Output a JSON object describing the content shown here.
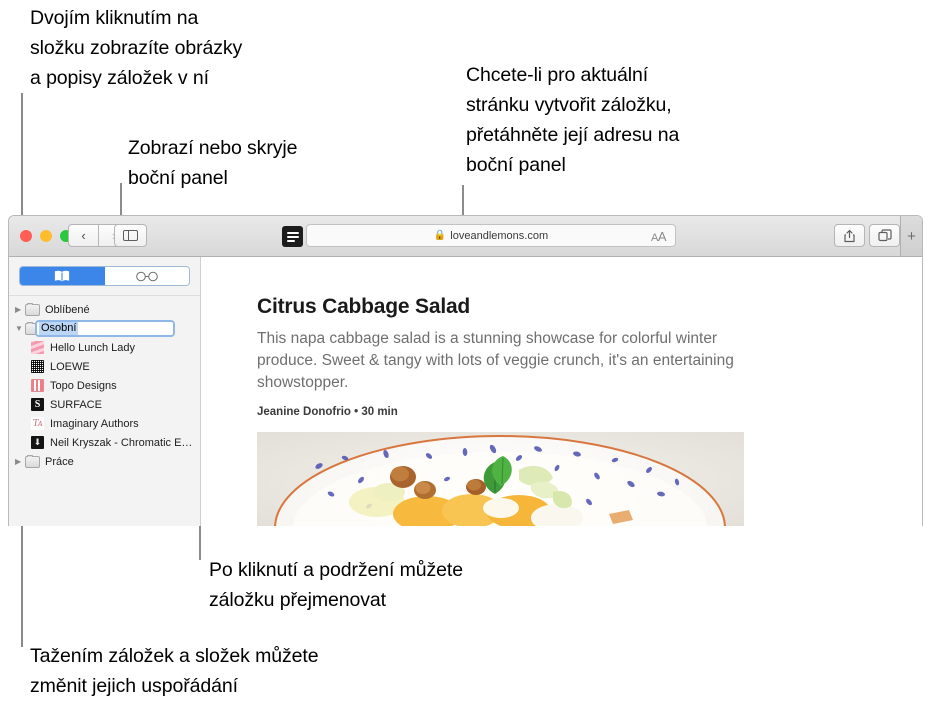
{
  "annotations": [
    {
      "id": "folder-doubleclick",
      "text": "Dvojím kliknutím na\nsložku zobrazíte obrázky\na popisy záložek v ní"
    },
    {
      "id": "sidebar-toggle",
      "text": "Zobrazí nebo skryje\nboční panel"
    },
    {
      "id": "drag-url",
      "text": "Chcete-li pro aktuální\nstránku vytvořit záložku,\npřetáhněte její adresu na\nboční panel"
    },
    {
      "id": "rename-bookmark",
      "text": "Po kliknutí a podržení můžete\nzáložku přejmenovat"
    },
    {
      "id": "reorder-bookmarks",
      "text": "Tažením záložek a složek můžete\nzměnit jejich uspořádání"
    }
  ],
  "browser": {
    "traffic_lights": {
      "close": "close-button",
      "minimize": "minimize-button",
      "zoom": "zoom-button"
    },
    "nav": {
      "back": "‹",
      "forward": "›"
    },
    "sidebar_toggle_icon": "sidebar-icon",
    "reader_icon": "reader-view-icon",
    "url": {
      "lock": "🔒",
      "text": "loveandlemons.com",
      "size_control": "aA"
    },
    "share_icon": "share-icon",
    "tab_overview_icon": "tab-overview-icon",
    "new_tab_label": "+"
  },
  "sidebar": {
    "tabs": [
      {
        "id": "bookmarks",
        "icon": "book-icon",
        "active": true
      },
      {
        "id": "reading-list",
        "icon": "glasses-icon",
        "active": false
      }
    ],
    "items": [
      {
        "type": "folder",
        "label": "Oblíbené",
        "expanded": false,
        "indent": 0
      },
      {
        "type": "folder",
        "label": "Osobní",
        "expanded": true,
        "indent": 0,
        "editing": true
      },
      {
        "type": "bookmark",
        "label": "Hello Lunch Lady",
        "favicon": "fi-lunch",
        "glyph": ""
      },
      {
        "type": "bookmark",
        "label": "LOEWE",
        "favicon": "fi-loewe",
        "glyph": ""
      },
      {
        "type": "bookmark",
        "label": "Topo Designs",
        "favicon": "fi-topo",
        "glyph": ""
      },
      {
        "type": "bookmark",
        "label": "SURFACE",
        "favicon": "fi-surface",
        "glyph": "S"
      },
      {
        "type": "bookmark",
        "label": "Imaginary Authors",
        "favicon": "fi-imaginary",
        "glyph": "Ƭᴀ"
      },
      {
        "type": "bookmark",
        "label": "Neil Kryszak - Chromatic E…",
        "favicon": "fi-neil",
        "glyph": "⬇"
      },
      {
        "type": "folder",
        "label": "Práce",
        "expanded": false,
        "indent": 0
      }
    ],
    "rename_value": "Osobní"
  },
  "content": {
    "title": "Citrus Cabbage Salad",
    "description": "This napa cabbage salad is a stunning showcase for colorful winter produce. Sweet & tangy with lots of veggie crunch, it's an entertaining showstopper.",
    "byline": "Jeanine Donofrio  •  30 min",
    "image_alt": "citrus-cabbage-salad-photo"
  },
  "colors": {
    "accent": "#3b86e8",
    "selection": "#bcd7f5",
    "leader": "#8b8b8b",
    "toolbar": "#e2e2e2"
  }
}
